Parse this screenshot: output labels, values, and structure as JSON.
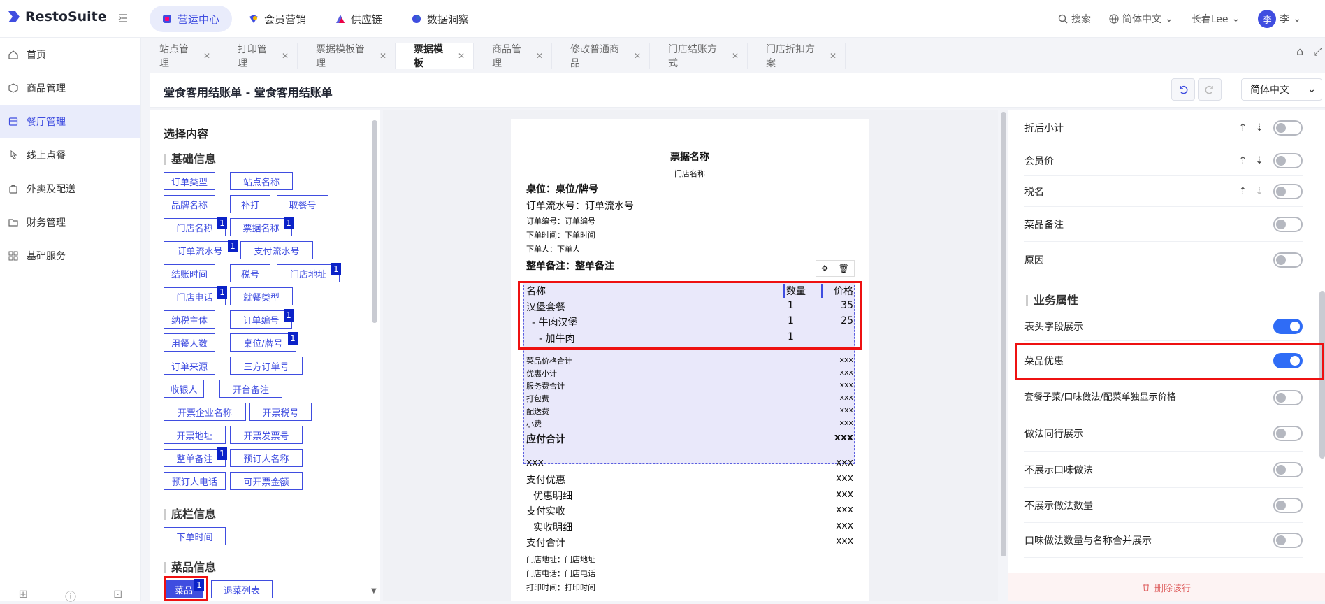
{
  "app": {
    "name": "RestoSuite"
  },
  "topnav": {
    "tabs": [
      {
        "label": "营运中心"
      },
      {
        "label": "会员营销"
      },
      {
        "label": "供应链"
      },
      {
        "label": "数据洞察"
      }
    ],
    "search_label": "搜索",
    "language": "简体中文",
    "store": "长春Lee",
    "user_initial": "李",
    "user_name": "李"
  },
  "sidebar": {
    "items": [
      {
        "label": "首页"
      },
      {
        "label": "商品管理"
      },
      {
        "label": "餐厅管理"
      },
      {
        "label": "线上点餐"
      },
      {
        "label": "外卖及配送"
      },
      {
        "label": "财务管理"
      },
      {
        "label": "基础服务"
      }
    ]
  },
  "page_tabs": [
    {
      "label": "站点管理"
    },
    {
      "label": "打印管理"
    },
    {
      "label": "票据模板管理"
    },
    {
      "label": "票据模板"
    },
    {
      "label": "商品管理"
    },
    {
      "label": "修改普通商品"
    },
    {
      "label": "门店结账方式"
    },
    {
      "label": "门店折扣方案"
    }
  ],
  "header": {
    "title": "堂食客用结账单 - 堂食客用结账单",
    "language": "简体中文"
  },
  "left_panel": {
    "title": "选择内容",
    "sections": {
      "basic": "基础信息",
      "footer": "底栏信息",
      "dish": "菜品信息"
    },
    "chips": [
      {
        "label": "订单类型",
        "badge": ""
      },
      {
        "label": "站点名称",
        "badge": ""
      },
      {
        "label": "品牌名称",
        "badge": ""
      },
      {
        "label": "补打",
        "badge": ""
      },
      {
        "label": "取餐号",
        "badge": ""
      },
      {
        "label": "门店名称",
        "badge": "1"
      },
      {
        "label": "票据名称",
        "badge": "1"
      },
      {
        "label": "订单流水号",
        "badge": "1"
      },
      {
        "label": "支付流水号",
        "badge": ""
      },
      {
        "label": "结账时间",
        "badge": ""
      },
      {
        "label": "税号",
        "badge": ""
      },
      {
        "label": "门店地址",
        "badge": "1"
      },
      {
        "label": "门店电话",
        "badge": "1"
      },
      {
        "label": "就餐类型",
        "badge": ""
      },
      {
        "label": "纳税主体",
        "badge": ""
      },
      {
        "label": "订单编号",
        "badge": "1"
      },
      {
        "label": "用餐人数",
        "badge": ""
      },
      {
        "label": "桌位/牌号",
        "badge": "1"
      },
      {
        "label": "订单来源",
        "badge": ""
      },
      {
        "label": "三方订单号",
        "badge": ""
      },
      {
        "label": "收银人",
        "badge": ""
      },
      {
        "label": "开台备注",
        "badge": ""
      },
      {
        "label": "开票企业名称",
        "badge": ""
      },
      {
        "label": "开票税号",
        "badge": ""
      },
      {
        "label": "开票地址",
        "badge": ""
      },
      {
        "label": "开票发票号",
        "badge": ""
      },
      {
        "label": "整单备注",
        "badge": "1"
      },
      {
        "label": "预订人名称",
        "badge": ""
      },
      {
        "label": "预订人电话",
        "badge": ""
      },
      {
        "label": "可开票金额",
        "badge": ""
      },
      {
        "label": "下单时间",
        "badge": ""
      },
      {
        "label": "菜品",
        "badge": "1"
      },
      {
        "label": "退菜列表",
        "badge": ""
      }
    ]
  },
  "receipt": {
    "title": "票据名称",
    "store_name": "门店名称",
    "table": "桌位：桌位/牌号",
    "serial": "订单流水号：订单流水号",
    "order_no": "订单编号：订单编号",
    "order_time": "下单时间：下单时间",
    "order_by": "下单人：下单人",
    "remark": "整单备注：整单备注",
    "item_headers": {
      "name": "名称",
      "qty": "数量",
      "price": "价格"
    },
    "items": [
      {
        "name": "汉堡套餐",
        "qty": "1",
        "price": "35"
      },
      {
        "name": "- 牛肉汉堡",
        "qty": "1",
        "price": "25"
      },
      {
        "name": "- 加牛肉",
        "qty": "1",
        "price": ""
      }
    ],
    "summary": [
      {
        "label": "菜品价格合计",
        "value": "xxx"
      },
      {
        "label": "优惠小计",
        "value": "xxx"
      },
      {
        "label": "服务费合计",
        "value": "xxx"
      },
      {
        "label": "打包费",
        "value": "xxx"
      },
      {
        "label": "配送费",
        "value": "xxx"
      },
      {
        "label": "小费",
        "value": "xxx"
      }
    ],
    "total": {
      "label": "应付合计",
      "value": "xxx"
    },
    "payments": [
      {
        "label": "xxx",
        "value": "xxx"
      },
      {
        "label": "支付优惠",
        "value": "xxx"
      },
      {
        "label": "优惠明细",
        "value": "xxx"
      },
      {
        "label": "支付实收",
        "value": "xxx"
      },
      {
        "label": "实收明细",
        "value": "xxx"
      },
      {
        "label": "支付合计",
        "value": "xxx"
      }
    ],
    "footer_lines": [
      "门店地址：门店地址",
      "门店电话：门店电话",
      "打印时间：打印时间"
    ]
  },
  "right_panel": {
    "rows_top": [
      {
        "label": "折后小计",
        "on": false,
        "sort": true
      },
      {
        "label": "会员价",
        "on": false,
        "sort": true
      },
      {
        "label": "税名",
        "on": false,
        "sort": true
      },
      {
        "label": "菜品备注",
        "on": false,
        "sort": false
      },
      {
        "label": "原因",
        "on": false,
        "sort": false
      }
    ],
    "section_title": "业务属性",
    "rows_business": [
      {
        "label": "表头字段展示",
        "on": true
      },
      {
        "label": "菜品优惠",
        "on": true
      },
      {
        "label": "套餐子菜/口味做法/配菜单独显示价格",
        "on": false
      },
      {
        "label": "做法同行展示",
        "on": false
      },
      {
        "label": "不展示口味做法",
        "on": false
      },
      {
        "label": "不展示做法数量",
        "on": false
      },
      {
        "label": "口味做法数量与名称合并展示",
        "on": false
      }
    ],
    "delete_row": "删除该行"
  },
  "colors": {
    "accent": "#3f4de0",
    "toggle_on": "#2f6cf6",
    "highlight": "#e11111",
    "badge": "#0b22c8"
  }
}
